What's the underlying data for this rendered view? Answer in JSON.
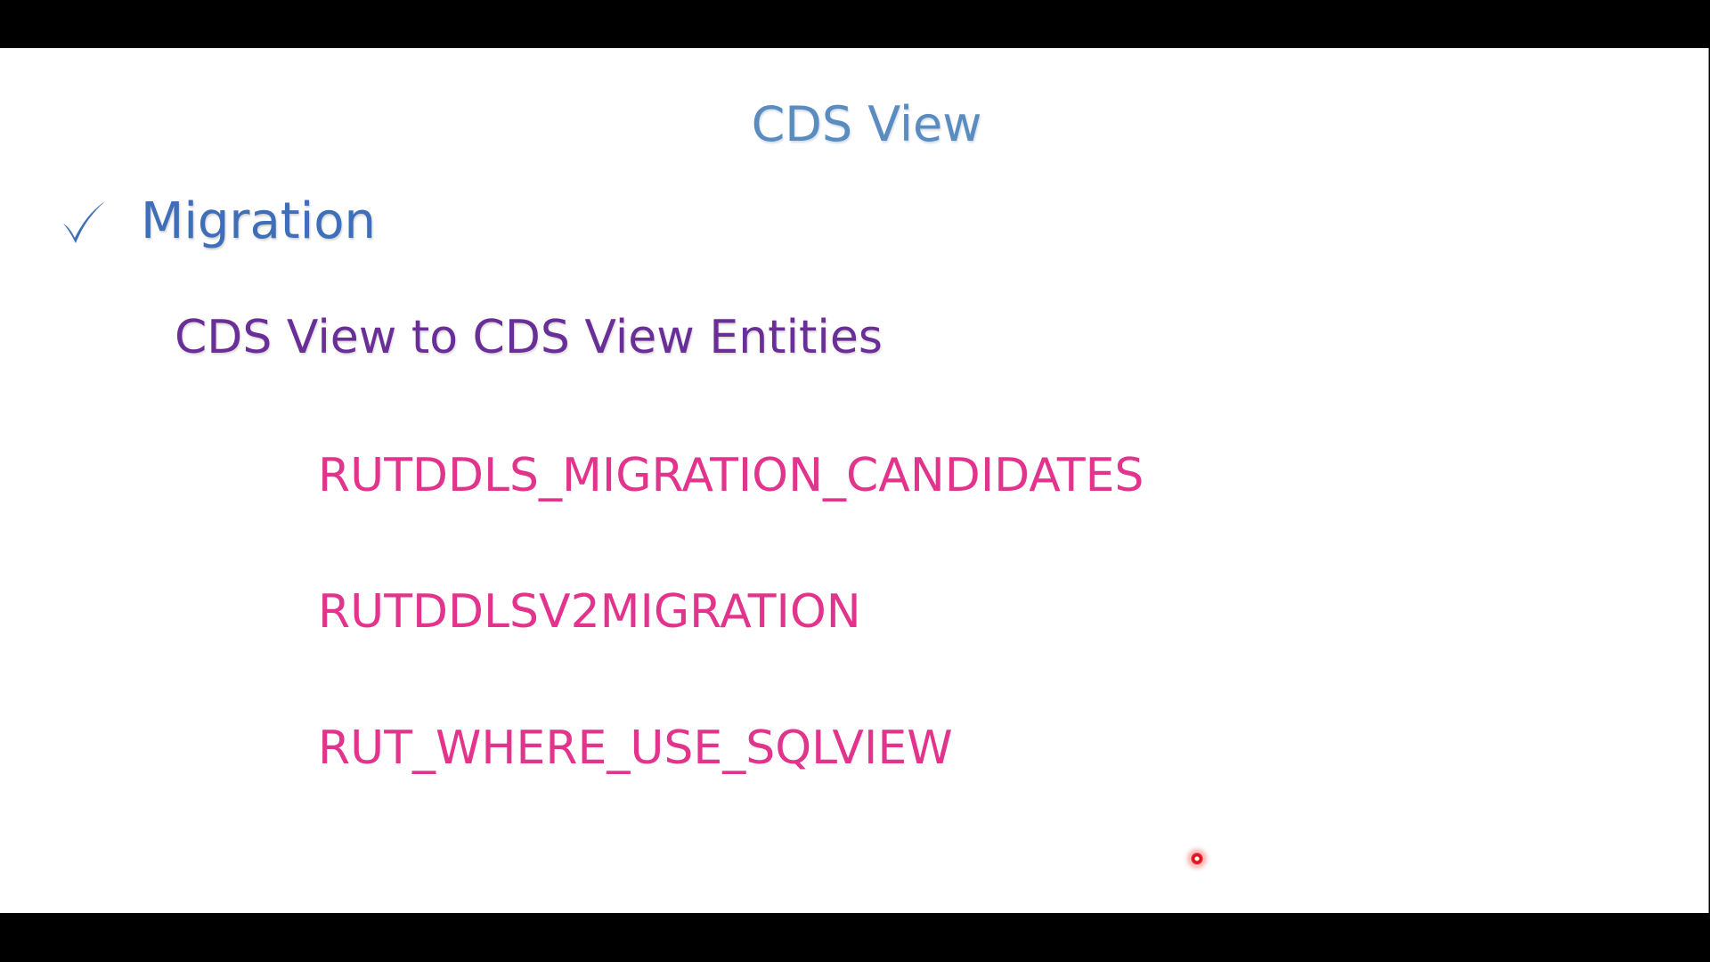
{
  "slide": {
    "title": "CDS View",
    "bullet": {
      "icon": "checkmark-icon",
      "text": "Migration"
    },
    "subheading": "CDS View to CDS View Entities",
    "programs": [
      "RUTDDLS_MIGRATION_CANDIDATES",
      "RUTDDLSV2MIGRATION",
      "RUT_WHERE_USE_SQLVIEW"
    ]
  },
  "colors": {
    "title": "#5b8cc0",
    "bullet": "#3f6fb8",
    "subheading": "#6a2f97",
    "programs": "#e2338d",
    "laser_pointer": "#e0101a",
    "background": "#ffffff",
    "letterbox": "#000000"
  },
  "pointer": {
    "icon": "laser-pointer-icon"
  }
}
